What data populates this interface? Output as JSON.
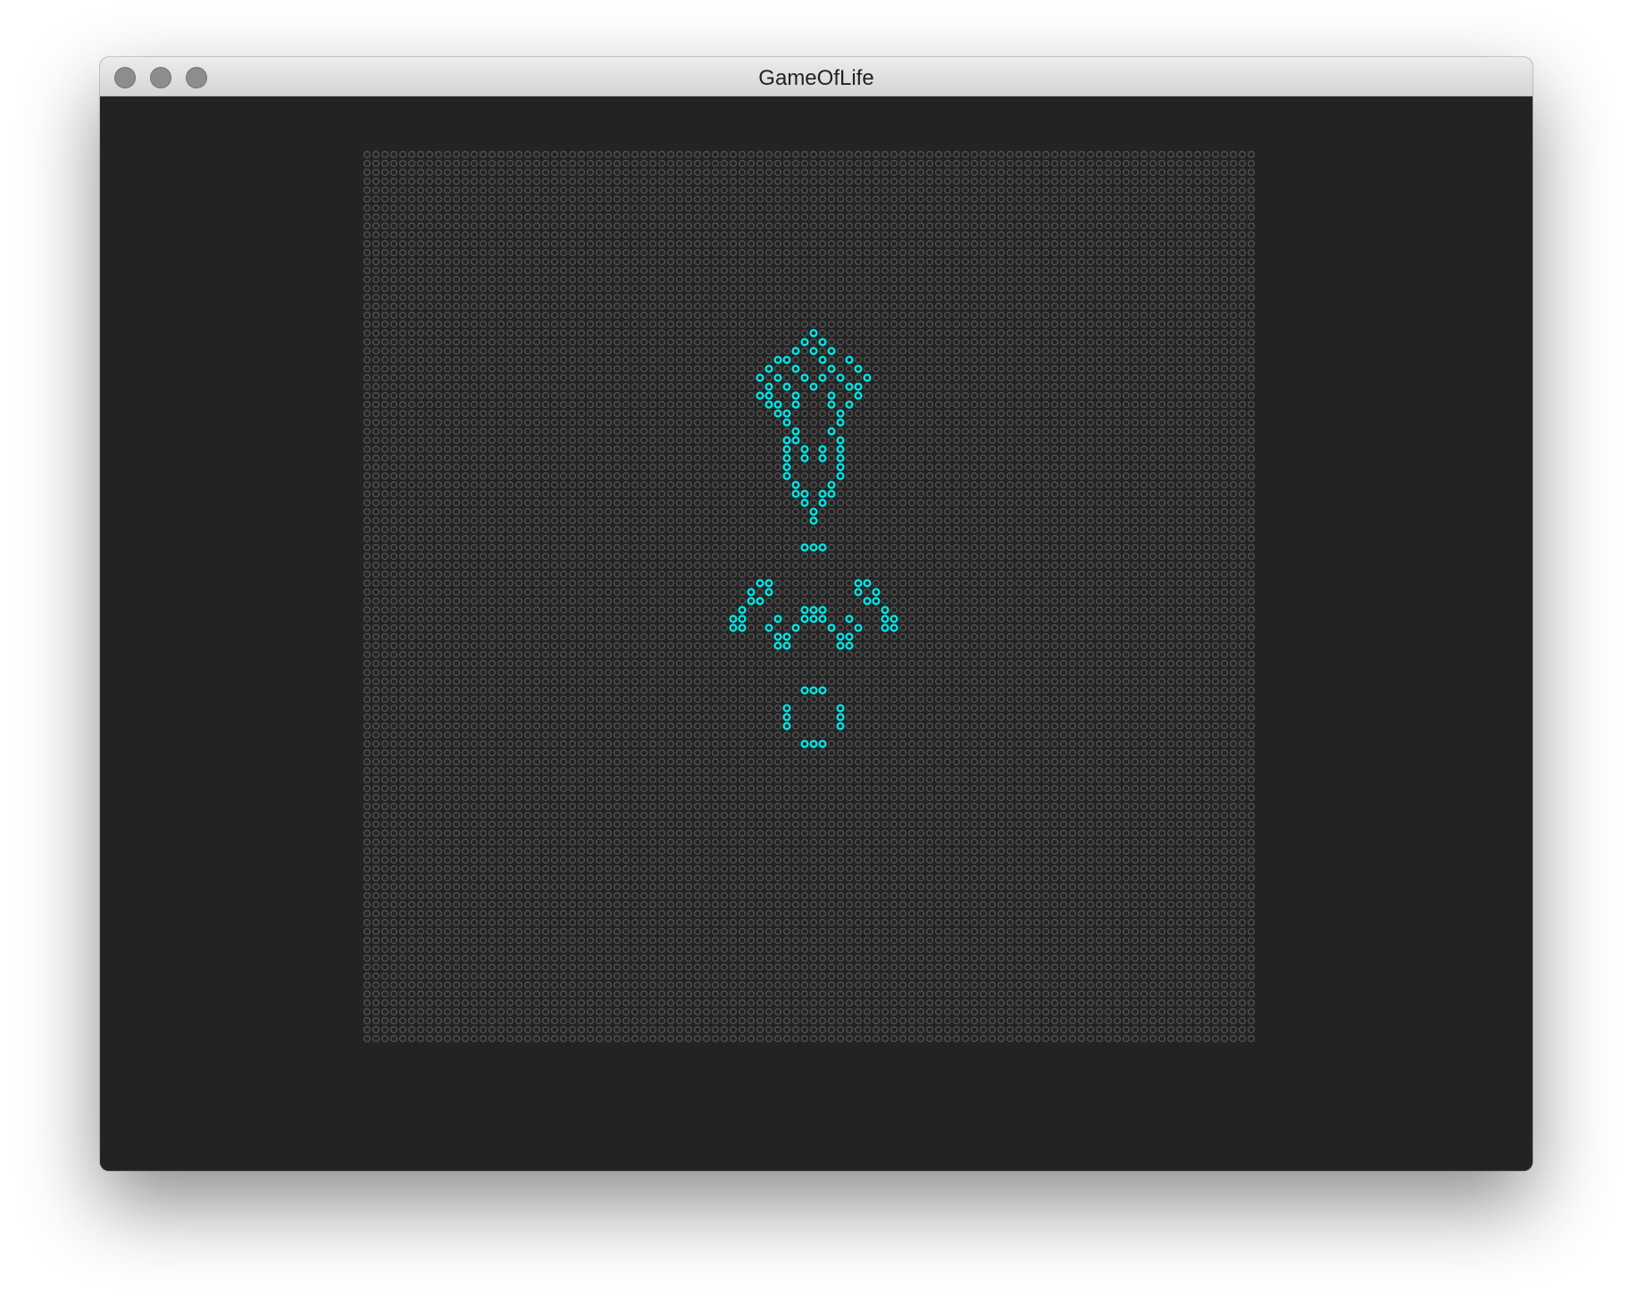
{
  "window": {
    "title": "GameOfLife"
  },
  "colors": {
    "background": "#232323",
    "dead_cell": "#4e4e4e",
    "live_cell": "#00e6e6",
    "traffic_light": "#8d8c8e"
  },
  "board": {
    "columns": 100,
    "rows": 100,
    "live_cells": [
      [
        50,
        20
      ],
      [
        49,
        21
      ],
      [
        51,
        21
      ],
      [
        48,
        22
      ],
      [
        50,
        22
      ],
      [
        52,
        22
      ],
      [
        46,
        23
      ],
      [
        47,
        23
      ],
      [
        51,
        23
      ],
      [
        54,
        23
      ],
      [
        45,
        24
      ],
      [
        48,
        24
      ],
      [
        52,
        24
      ],
      [
        55,
        24
      ],
      [
        44,
        25
      ],
      [
        46,
        25
      ],
      [
        49,
        25
      ],
      [
        51,
        25
      ],
      [
        53,
        25
      ],
      [
        56,
        25
      ],
      [
        45,
        26
      ],
      [
        47,
        26
      ],
      [
        50,
        26
      ],
      [
        54,
        26
      ],
      [
        55,
        26
      ],
      [
        44,
        27
      ],
      [
        45,
        27
      ],
      [
        48,
        27
      ],
      [
        52,
        27
      ],
      [
        55,
        27
      ],
      [
        45,
        28
      ],
      [
        46,
        28
      ],
      [
        48,
        28
      ],
      [
        52,
        28
      ],
      [
        54,
        28
      ],
      [
        46,
        29
      ],
      [
        47,
        29
      ],
      [
        53,
        29
      ],
      [
        47,
        30
      ],
      [
        53,
        30
      ],
      [
        48,
        31
      ],
      [
        52,
        31
      ],
      [
        47,
        32
      ],
      [
        48,
        32
      ],
      [
        53,
        32
      ],
      [
        47,
        33
      ],
      [
        49,
        33
      ],
      [
        51,
        33
      ],
      [
        53,
        33
      ],
      [
        47,
        34
      ],
      [
        49,
        34
      ],
      [
        51,
        34
      ],
      [
        53,
        34
      ],
      [
        47,
        35
      ],
      [
        53,
        35
      ],
      [
        47,
        36
      ],
      [
        53,
        36
      ],
      [
        48,
        37
      ],
      [
        52,
        37
      ],
      [
        48,
        38
      ],
      [
        49,
        38
      ],
      [
        51,
        38
      ],
      [
        52,
        38
      ],
      [
        49,
        39
      ],
      [
        51,
        39
      ],
      [
        50,
        40
      ],
      [
        50,
        41
      ],
      [
        49,
        44
      ],
      [
        50,
        44
      ],
      [
        51,
        44
      ],
      [
        44,
        48
      ],
      [
        45,
        48
      ],
      [
        55,
        48
      ],
      [
        56,
        48
      ],
      [
        43,
        49
      ],
      [
        45,
        49
      ],
      [
        55,
        49
      ],
      [
        57,
        49
      ],
      [
        43,
        50
      ],
      [
        44,
        50
      ],
      [
        56,
        50
      ],
      [
        57,
        50
      ],
      [
        42,
        51
      ],
      [
        49,
        51
      ],
      [
        50,
        51
      ],
      [
        51,
        51
      ],
      [
        58,
        51
      ],
      [
        41,
        52
      ],
      [
        42,
        52
      ],
      [
        46,
        52
      ],
      [
        49,
        52
      ],
      [
        50,
        52
      ],
      [
        51,
        52
      ],
      [
        54,
        52
      ],
      [
        58,
        52
      ],
      [
        59,
        52
      ],
      [
        41,
        53
      ],
      [
        42,
        53
      ],
      [
        45,
        53
      ],
      [
        48,
        53
      ],
      [
        52,
        53
      ],
      [
        55,
        53
      ],
      [
        58,
        53
      ],
      [
        59,
        53
      ],
      [
        46,
        54
      ],
      [
        47,
        54
      ],
      [
        53,
        54
      ],
      [
        54,
        54
      ],
      [
        46,
        55
      ],
      [
        47,
        55
      ],
      [
        53,
        55
      ],
      [
        54,
        55
      ],
      [
        49,
        60
      ],
      [
        50,
        60
      ],
      [
        51,
        60
      ],
      [
        47,
        62
      ],
      [
        53,
        62
      ],
      [
        47,
        63
      ],
      [
        53,
        63
      ],
      [
        47,
        64
      ],
      [
        53,
        64
      ],
      [
        49,
        66
      ],
      [
        50,
        66
      ],
      [
        51,
        66
      ]
    ]
  }
}
